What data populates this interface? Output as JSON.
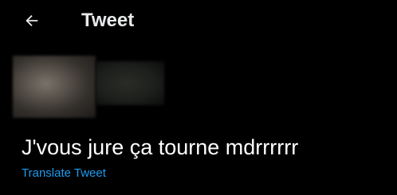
{
  "header": {
    "title": "Tweet",
    "back_icon": "arrow-left-icon"
  },
  "tweet": {
    "text": "J'vous jure ça tourne mdrrrrrr",
    "translate_label": "Translate Tweet"
  },
  "colors": {
    "background": "#000000",
    "text": "#ffffff",
    "link": "#1d9bf0"
  }
}
